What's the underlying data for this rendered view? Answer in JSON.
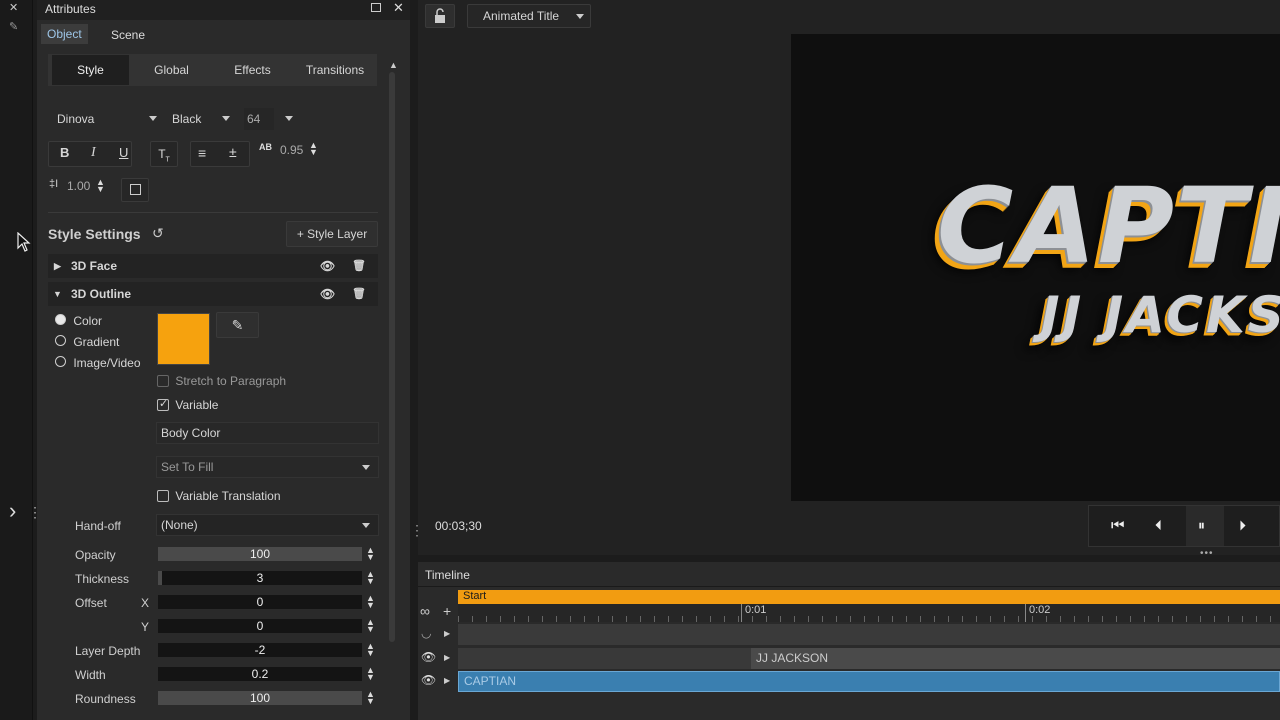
{
  "strip": {
    "close_glyph": "✕",
    "pin_glyph": "✎",
    "expand_glyph": "›",
    "more_glyph": "⋮"
  },
  "panel": {
    "title": "Attributes",
    "tabs": [
      "Object",
      "Scene"
    ],
    "subtabs": [
      "Style",
      "Global",
      "Effects",
      "Transitions"
    ],
    "font": {
      "family": "Dinova",
      "weight": "Black",
      "size": "64"
    },
    "format": {
      "bold": "B",
      "italic": "I",
      "underline": "U",
      "tracking_label": "AB",
      "tracking": "0.95",
      "leading": "1.00"
    },
    "style_settings": {
      "title": "Style Settings",
      "add_layer": "+ Style Layer"
    },
    "layers": [
      {
        "name": "3D Face",
        "expanded": false
      },
      {
        "name": "3D Outline",
        "expanded": true
      }
    ],
    "fill_types": [
      {
        "label": "Color",
        "selected": true
      },
      {
        "label": "Gradient",
        "selected": false
      },
      {
        "label": "Image/Video",
        "selected": false
      }
    ],
    "swatch_color": "#f6a20e",
    "stretch": {
      "label": "Stretch to Paragraph",
      "checked": false
    },
    "variable": {
      "label": "Variable",
      "checked": true
    },
    "variable_name": "Body Color",
    "set_to": "Set To Fill",
    "variable_translation": {
      "label": "Variable Translation",
      "checked": false
    },
    "handoff": {
      "label": "Hand-off",
      "value": "(None)"
    },
    "params": [
      {
        "label": "Opacity",
        "axis": "",
        "value": "100",
        "fill": 1.0
      },
      {
        "label": "Thickness",
        "axis": "",
        "value": "3",
        "fill": 0.02
      },
      {
        "label": "Offset",
        "axis": "X",
        "value": "0",
        "fill": 0
      },
      {
        "label": "",
        "axis": "Y",
        "value": "0",
        "fill": 0
      },
      {
        "label": "Layer Depth",
        "axis": "",
        "value": "-2",
        "fill": 0
      },
      {
        "label": "Width",
        "axis": "",
        "value": "0.2",
        "fill": 0
      },
      {
        "label": "Roundness",
        "axis": "",
        "value": "100",
        "fill": 1.0
      }
    ]
  },
  "viewer": {
    "title_dropdown": "Animated Title",
    "timecode": "00:03;30",
    "caption_line1": "CAPTI",
    "caption_line2": "JJ JACKS",
    "accent": "#f2a516"
  },
  "timeline": {
    "title": "Timeline",
    "start_label": "Start",
    "ticks": [
      "0:01",
      "0:02"
    ],
    "tracks": [
      "JJ JACKSON",
      "CAPTIAN"
    ],
    "accent": "#f29c11",
    "clip_color": "#3a7fb0"
  }
}
